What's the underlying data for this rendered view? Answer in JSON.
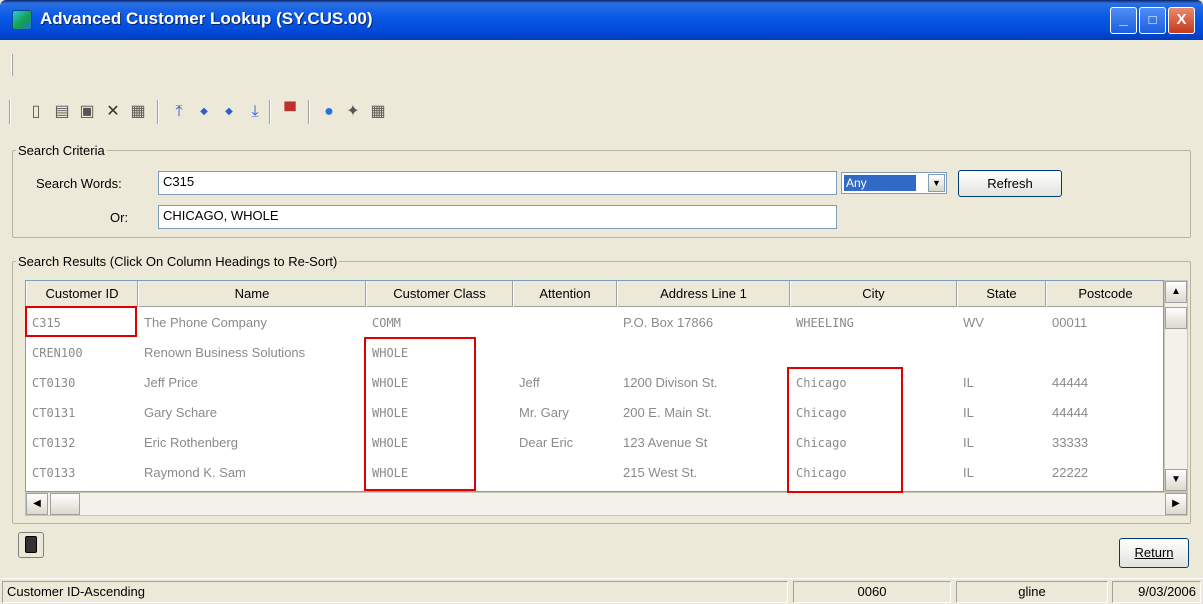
{
  "window": {
    "title": "Advanced Customer Lookup (SY.CUS.00)",
    "minimize": "_",
    "maximize": "□",
    "close": "X"
  },
  "toolbar": {
    "icons": [
      "new-icon",
      "save-icon",
      "copy-icon",
      "delete-icon",
      "paste-icon",
      "first-record-icon",
      "previous-record-icon",
      "next-record-icon",
      "last-record-icon",
      "screen-icon",
      "help-icon",
      "tools-icon",
      "calculator-icon"
    ],
    "glyphs": [
      "▯",
      "▤",
      "▣",
      "✕",
      "▦",
      "⤒",
      "◆",
      "◆",
      "⤓",
      "▀",
      "●",
      "✦",
      "▦"
    ]
  },
  "search_criteria": {
    "legend": "Search Criteria",
    "search_words_label": "Search Words:",
    "search_words_value": "C315",
    "or_label": "Or:",
    "or_value": "CHICAGO, WHOLE",
    "match_selected": "Any",
    "refresh_label": "Refresh"
  },
  "results": {
    "legend": "Search Results (Click On Column Headings to Re-Sort)",
    "columns": [
      "Customer ID",
      "Name",
      "Customer Class",
      "Attention",
      "Address Line 1",
      "City",
      "State",
      "Postcode"
    ],
    "rows": [
      [
        "C315",
        "The Phone Company",
        "COMM",
        "",
        "P.O. Box 17866",
        "WHEELING",
        "WV",
        "00011"
      ],
      [
        "CREN100",
        "Renown Business Solutions",
        "WHOLE",
        "",
        "",
        "",
        "",
        ""
      ],
      [
        "CT0130",
        "Jeff Price",
        "WHOLE",
        "Jeff",
        "1200 Divison St.",
        "Chicago",
        "IL",
        "44444"
      ],
      [
        "CT0131",
        "Gary Schare",
        "WHOLE",
        "Mr. Gary",
        "200 E. Main St.",
        "Chicago",
        "IL",
        "44444"
      ],
      [
        "CT0132",
        "Eric Rothenberg",
        "WHOLE",
        "Dear Eric",
        "123 Avenue St",
        "Chicago",
        "IL",
        "33333"
      ],
      [
        "CT0133",
        "Raymond K. Sam",
        "WHOLE",
        "",
        "215 West St.",
        "Chicago",
        "IL",
        "22222"
      ]
    ]
  },
  "footer": {
    "return_label": "Return"
  },
  "status": {
    "sort": "Customer ID-Ascending",
    "company": "0060",
    "user": "gline",
    "date": "9/03/2006"
  },
  "colors": {
    "highlight": "#e00000",
    "selection": "#316ac5",
    "titlebar": "#0b5ae8"
  }
}
